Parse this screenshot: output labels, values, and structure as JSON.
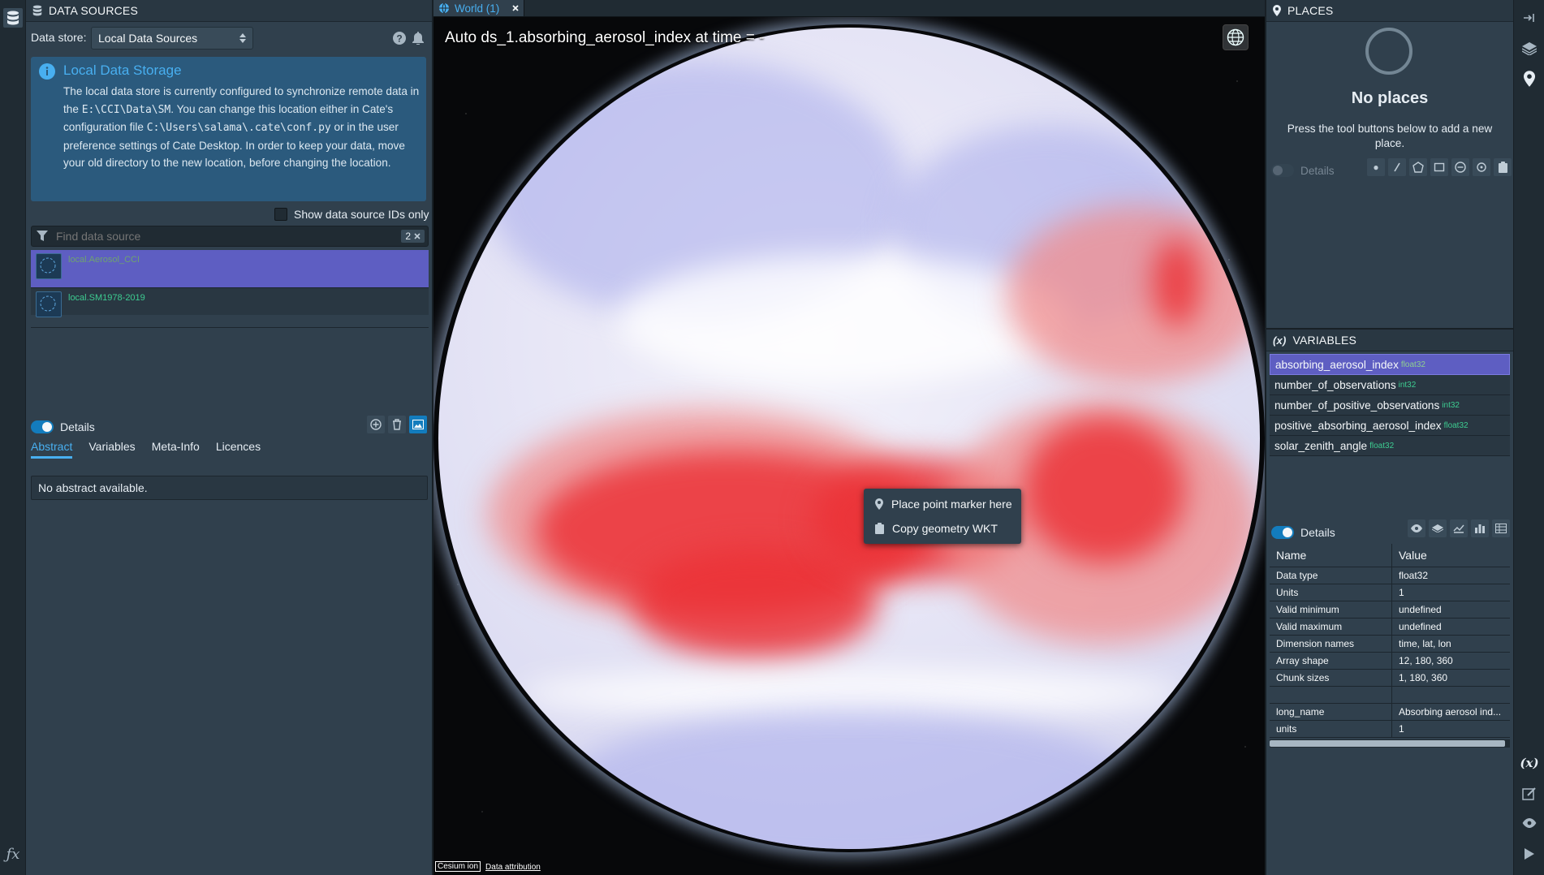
{
  "left_panel": {
    "title": "DATA SOURCES",
    "store_label": "Data store:",
    "store_value": "Local Data Sources",
    "callout": {
      "title": "Local Data Storage",
      "text1": "The local data store is currently configured to synchronize remote data in the",
      "path1": "E:\\CCI\\Data\\SM",
      "text2": ". You can change this location either in Cate's configuration file",
      "path2": "C:\\Users\\salama\\.cate\\conf.py",
      "text3": "or in the user preference settings of Cate Desktop. In order to keep your data, move your old directory to the new location, before changing the location."
    },
    "show_ids_label": "Show data source IDs only",
    "search_placeholder": "Find data source",
    "result_count": "2",
    "data_sources": [
      "local.Aerosol_CCI",
      "local.SM1978-2019"
    ],
    "details_label": "Details",
    "tabs": [
      "Abstract",
      "Variables",
      "Meta-Info",
      "Licences"
    ],
    "abstract_text": "No abstract available."
  },
  "center": {
    "tab_label": "World (1)",
    "title": "Auto ds_1.absorbing_aerosol_index at time = -",
    "context_menu": [
      "Place point marker here",
      "Copy geometry WKT"
    ],
    "credit_logo": "Cesium ion",
    "credit_link": "Data attribution"
  },
  "places": {
    "title": "PLACES",
    "empty_title": "No places",
    "empty_text": "Press the tool buttons below to add a new place.",
    "details_label": "Details"
  },
  "variables": {
    "title": "VARIABLES",
    "items": [
      {
        "name": "absorbing_aerosol_index",
        "type": "float32"
      },
      {
        "name": "number_of_observations",
        "type": "int32"
      },
      {
        "name": "number_of_positive_observations",
        "type": "int32"
      },
      {
        "name": "positive_absorbing_aerosol_index",
        "type": "float32"
      },
      {
        "name": "solar_zenith_angle",
        "type": "float32"
      }
    ],
    "details_label": "Details",
    "table_headers": [
      "Name",
      "Value"
    ],
    "props": [
      [
        "Data type",
        "float32"
      ],
      [
        "Units",
        "1"
      ],
      [
        "Valid minimum",
        "undefined"
      ],
      [
        "Valid maximum",
        "undefined"
      ],
      [
        "Dimension names",
        "time, lat, lon"
      ],
      [
        "Array shape",
        "12, 180, 360"
      ],
      [
        "Chunk sizes",
        "1, 180, 360"
      ],
      [
        "",
        ""
      ],
      [
        "long_name",
        "Absorbing aerosol ind..."
      ],
      [
        "units",
        "1"
      ]
    ]
  },
  "colors": {
    "accent": "#48aff0",
    "selection": "#5e5ec2",
    "dtype": "#3dcc91",
    "panel_bg": "#30404d"
  }
}
